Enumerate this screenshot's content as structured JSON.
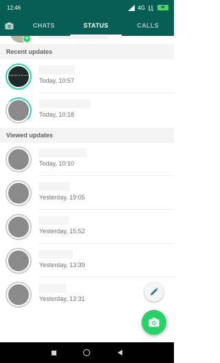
{
  "status_bar": {
    "time": "12:46",
    "network": "4G",
    "battery": "88"
  },
  "tabs": [
    {
      "label": "CHATS",
      "active": false
    },
    {
      "label": "STATUS",
      "active": true
    },
    {
      "label": "CALLS",
      "active": false
    }
  ],
  "sections": {
    "recent_title": "Recent updates",
    "viewed_title": "Viewed updates"
  },
  "recent_updates": [
    {
      "time": "Today, 10:57",
      "thumb_text": "Happiness is the secret way"
    },
    {
      "time": "Today, 10:18"
    }
  ],
  "viewed_updates": [
    {
      "time": "Today, 10:10"
    },
    {
      "time": "Yesterday, 19:05"
    },
    {
      "time": "Yesterday, 15:52"
    },
    {
      "time": "Yesterday, 13:39"
    },
    {
      "time": "Yesterday, 13:31"
    }
  ],
  "colors": {
    "primary": "#075e54",
    "accent": "#25d366",
    "ring_unseen": "#25d3b0",
    "ring_seen": "#cccccc"
  },
  "icons": {
    "camera_tab": "camera-icon",
    "pencil_fab": "pencil-icon",
    "camera_fab": "camera-icon",
    "nav": [
      "recents-square-icon",
      "home-circle-icon",
      "back-triangle-icon"
    ]
  }
}
